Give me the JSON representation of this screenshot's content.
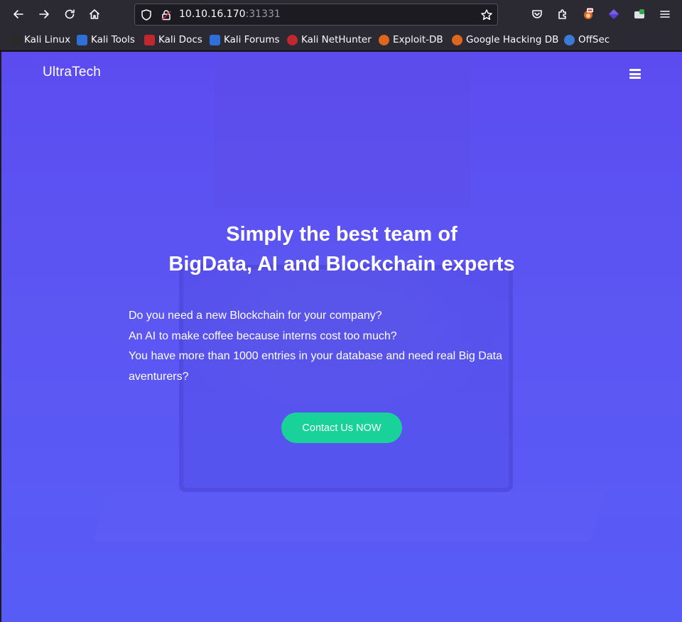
{
  "browser": {
    "url_host": "10.10.16.170",
    "url_port": ":31331",
    "icons": [
      "back-arrow-icon",
      "forward-arrow-icon",
      "reload-icon",
      "home-icon",
      "shield-icon",
      "lock-icon",
      "star-icon",
      "pocket-icon",
      "extensions-icon",
      "foxyproxy-icon",
      "extension-purple-icon",
      "extension-green-icon",
      "hamburger-menu-icon"
    ]
  },
  "bookmarks": [
    {
      "label": "Kali Linux",
      "color": "#2a2a2a"
    },
    {
      "label": "Kali Tools",
      "color": "#2f6fd8"
    },
    {
      "label": "Kali Docs",
      "color": "#c0282d"
    },
    {
      "label": "Kali Forums",
      "color": "#2f6fd8"
    },
    {
      "label": "Kali NetHunter",
      "color": "#c0282d"
    },
    {
      "label": "Exploit-DB",
      "color": "#e0661e"
    },
    {
      "label": "Google Hacking DB",
      "color": "#e0661e"
    },
    {
      "label": "OffSec",
      "color": "#3a7bd5"
    }
  ],
  "site": {
    "brand": "UltraTech",
    "headline_line1": "Simply the best team of",
    "headline_line2": "BigData, AI and Blockchain experts",
    "intro_lines": [
      "Do you need a new Blockchain for your company?",
      "An AI to make coffee because interns cost too much?",
      "You have more than 1000 entries in your database and need real Big Data aventurers?"
    ],
    "cta_label": "Contact Us NOW",
    "accent": "#19d29a",
    "background": "#5c56f3"
  }
}
